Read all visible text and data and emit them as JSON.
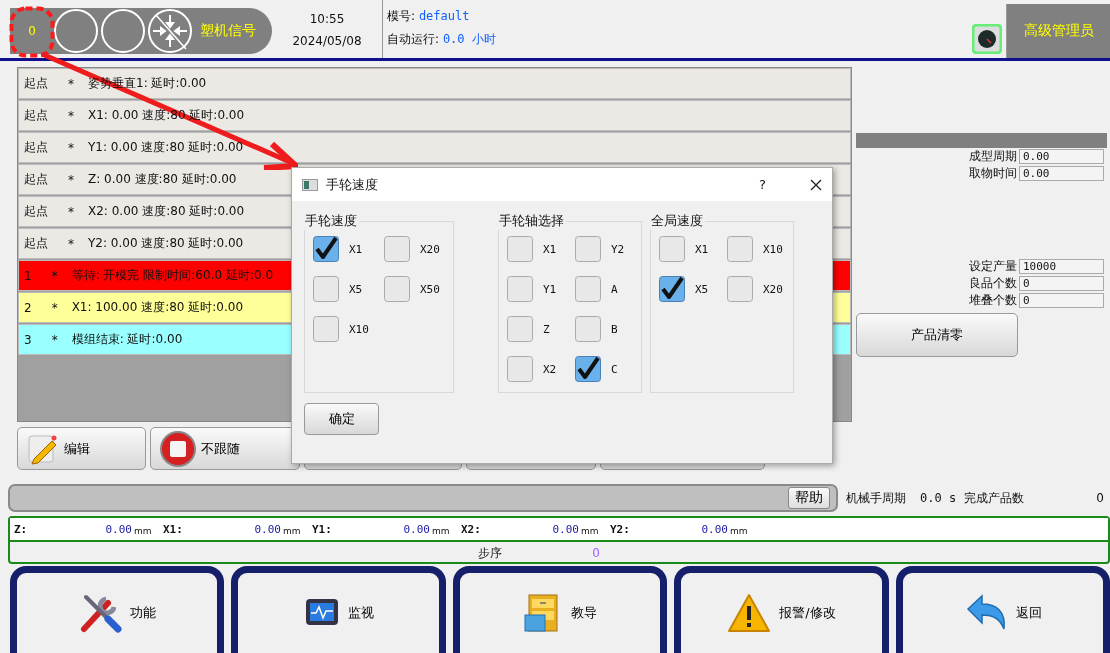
{
  "header": {
    "signal_count": "0",
    "signal_label": "塑机信号",
    "time": "10:55",
    "date": "2024/05/08",
    "mold_label": "模号:",
    "mold_value": "default",
    "run_label": "自动运行:",
    "run_value": "0.0 小时",
    "user": "高级管理员"
  },
  "program": {
    "rows": [
      {
        "step": "起点",
        "mark": "*",
        "text": "姿势垂直1:  延时:0.00",
        "color": "#ece9e4"
      },
      {
        "step": "起点",
        "mark": "*",
        "text": "X1: 0.00 速度:80  延时:0.00",
        "color": "#ece9e4"
      },
      {
        "step": "起点",
        "mark": "*",
        "text": "Y1: 0.00 速度:80  延时:0.00",
        "color": "#ece9e4"
      },
      {
        "step": "起点",
        "mark": "*",
        "text": "Z: 0.00 速度:80  延时:0.00",
        "color": "#ece9e4"
      },
      {
        "step": "起点",
        "mark": "*",
        "text": "X2: 0.00 速度:80  延时:0.00",
        "color": "#ece9e4"
      },
      {
        "step": "起点",
        "mark": "*",
        "text": "Y2: 0.00 速度:80  延时:0.00",
        "color": "#ece9e4"
      },
      {
        "step": "1",
        "mark": "*",
        "text": "等待: 开模完 限制时间:60.0 延时:0.0",
        "color": "#ff0000"
      },
      {
        "step": "2",
        "mark": "*",
        "text": "X1: 100.00 速度:80  延时:0.00",
        "color": "#ffff99"
      },
      {
        "step": "3",
        "mark": "*",
        "text": "模组结束:  延时:0.00",
        "color": "#99ffff"
      }
    ],
    "buttons": [
      {
        "label": "编辑"
      },
      {
        "label": "不跟随"
      }
    ]
  },
  "side_panel": {
    "time_fields": [
      {
        "label": "成型周期",
        "value": "0.00"
      },
      {
        "label": "取物时间",
        "value": "0.00"
      }
    ],
    "count_fields": [
      {
        "label": "设定产量",
        "value": "10000"
      },
      {
        "label": "良品个数",
        "value": "0"
      },
      {
        "label": "堆叠个数",
        "value": "0"
      }
    ],
    "clear_button": "产品清零"
  },
  "dialog": {
    "title": "手轮速度",
    "help": "?",
    "ok": "确定",
    "groups": [
      {
        "title": "手轮速度",
        "options": [
          {
            "label": "X1",
            "checked": true
          },
          {
            "label": "X20",
            "checked": false
          },
          {
            "label": "X5",
            "checked": false
          },
          {
            "label": "X50",
            "checked": false
          },
          {
            "label": "X10",
            "checked": false
          }
        ]
      },
      {
        "title": "手轮轴选择",
        "options": [
          {
            "label": "X1",
            "checked": false
          },
          {
            "label": "Y2",
            "checked": false
          },
          {
            "label": "Y1",
            "checked": false
          },
          {
            "label": "A",
            "checked": false
          },
          {
            "label": "Z",
            "checked": false
          },
          {
            "label": "B",
            "checked": false
          },
          {
            "label": "X2",
            "checked": false
          },
          {
            "label": "C",
            "checked": true
          }
        ]
      },
      {
        "title": "全局速度",
        "options": [
          {
            "label": "X1",
            "checked": false
          },
          {
            "label": "X10",
            "checked": false
          },
          {
            "label": "X5",
            "checked": true
          },
          {
            "label": "X20",
            "checked": false
          }
        ]
      }
    ]
  },
  "help_bar": {
    "help_button": "帮助",
    "cycle_label": "机械手周期",
    "cycle_value": "0.0 s",
    "done_label": "完成产品数",
    "done_value": "0"
  },
  "coordinates": [
    {
      "axis": "Z:",
      "value": "0.00",
      "unit": "mm"
    },
    {
      "axis": "X1:",
      "value": "0.00",
      "unit": "mm"
    },
    {
      "axis": "Y1:",
      "value": "0.00",
      "unit": "mm"
    },
    {
      "axis": "X2:",
      "value": "0.00",
      "unit": "mm"
    },
    {
      "axis": "Y2:",
      "value": "0.00",
      "unit": "mm"
    }
  ],
  "step": {
    "label": "步序",
    "value": "0"
  },
  "nav": [
    {
      "label": "功能"
    },
    {
      "label": "监视"
    },
    {
      "label": "教导"
    },
    {
      "label": "报警/修改"
    },
    {
      "label": "返回"
    }
  ]
}
